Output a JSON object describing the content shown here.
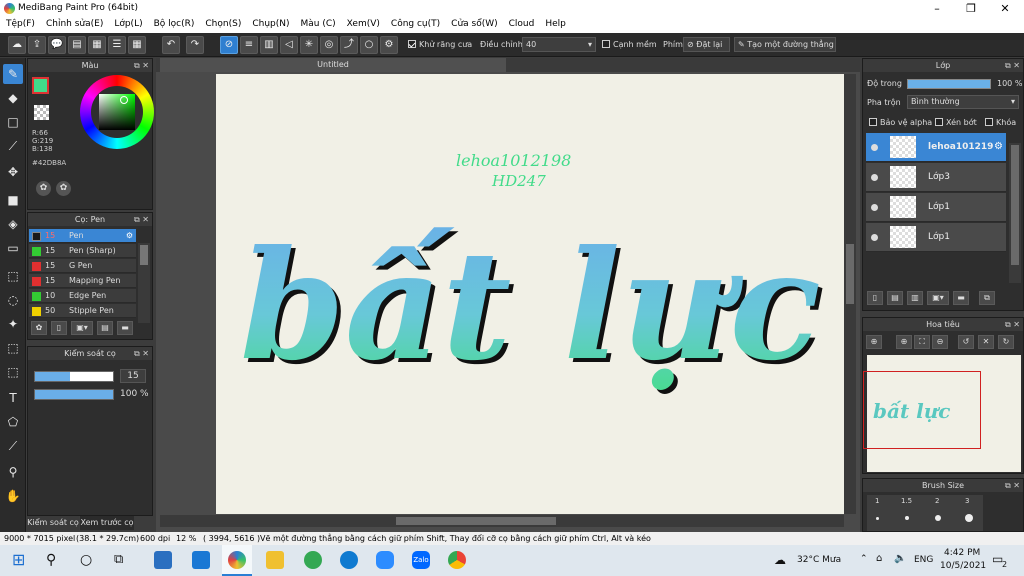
{
  "app": {
    "title": "MediBang Paint Pro (64bit)"
  },
  "menu": [
    "Tệp(F)",
    "Chỉnh sửa(E)",
    "Lớp(L)",
    "Bộ lọc(R)",
    "Chọn(S)",
    "Chụp(N)",
    "Màu (C)",
    "Xem(V)",
    "Công cụ(T)",
    "Cửa sổ(W)",
    "Cloud",
    "Help"
  ],
  "toolbar": {
    "antialias": "Khử răng cưa",
    "correction_label": "Điều chỉnh",
    "correction_value": "40",
    "soft_edge": "Cạnh mềm",
    "key_label": "Phím",
    "place_btn": "Đặt lại",
    "straight_btn": "Tạo một đường thẳng"
  },
  "color_panel": {
    "title": "Màu",
    "r": "R:66",
    "g": "G:219",
    "b": "B:138",
    "hex": "#42DB8A",
    "fg": "#42DB8A"
  },
  "brush_panel": {
    "title": "Cọ: Pen",
    "items": [
      {
        "size": "15",
        "name": "Pen",
        "color": "#1a1a1a"
      },
      {
        "size": "15",
        "name": "Pen (Sharp)",
        "color": "#33cc33"
      },
      {
        "size": "15",
        "name": "G Pen",
        "color": "#e03030"
      },
      {
        "size": "15",
        "name": "Mapping Pen",
        "color": "#e03030"
      },
      {
        "size": "10",
        "name": "Edge Pen",
        "color": "#33cc33"
      },
      {
        "size": "50",
        "name": "Stipple Pen",
        "color": "#f0d000"
      }
    ]
  },
  "brush_control": {
    "title": "Kiểm soát cọ",
    "size": "15",
    "opacity": "100 %",
    "size_fraction": 0.45,
    "opacity_fraction": 1.0
  },
  "bottom_tabs": {
    "tab1": "Kiểm soát cọ",
    "tab2": "Xem trước cọ"
  },
  "document": {
    "tab": "Untitled"
  },
  "canvas": {
    "main_text": "bất lực",
    "signature_line1": "lehoa1012198",
    "signature_line2": "HD247"
  },
  "layer_panel": {
    "title": "Lớp",
    "opacity_label": "Độ trong",
    "opacity_value": "100 %",
    "blend_label": "Pha trộn",
    "blend_value": "Bình thường",
    "protect_alpha": "Bảo vệ alpha",
    "clipping": "Xén bớt",
    "lock": "Khóa",
    "layers": [
      {
        "name": "lehoa101219"
      },
      {
        "name": "Lớp3"
      },
      {
        "name": "Lớp1"
      },
      {
        "name": "Lớp1"
      }
    ]
  },
  "navigator": {
    "title": "Hoa tiêu"
  },
  "brush_size": {
    "title": "Brush Size",
    "sizes": [
      "1",
      "1.5",
      "2",
      "3"
    ]
  },
  "status": {
    "size": "9000 * 7015 pixel",
    "cm": "(38.1 * 29.7cm)",
    "dpi": "600 dpi",
    "zoom": "12 %",
    "coords": "( 3994, 5616 )",
    "hint": "Vẽ một đường thẳng bằng cách giữ phím Shift, Thay đổi cỡ cọ bằng cách giữ phím Ctrl, Alt và kéo"
  },
  "taskbar": {
    "weather": "32°C Mưa",
    "lang": "ENG",
    "time": "4:42 PM",
    "date": "10/5/2021",
    "notif": "2"
  }
}
